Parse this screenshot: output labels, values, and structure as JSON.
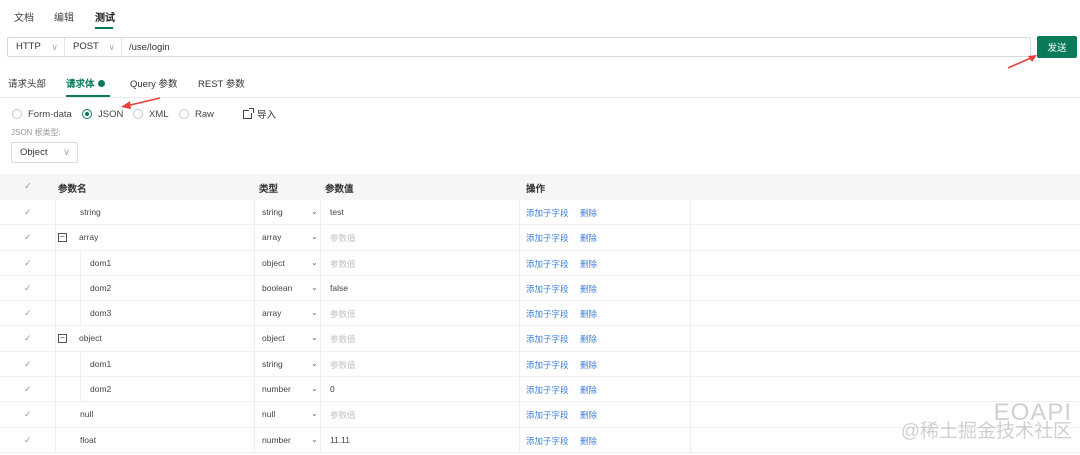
{
  "topnav": {
    "tabs": [
      "文档",
      "编辑",
      "测试"
    ],
    "active": 2
  },
  "request": {
    "protocol": "HTTP",
    "method": "POST",
    "url": "/use/login",
    "send_label": "发送"
  },
  "subtabs": {
    "items": [
      "请求头部",
      "请求体",
      "Query 参数",
      "REST 参数"
    ],
    "active": 1
  },
  "body_types": {
    "items": [
      "Form-data",
      "JSON",
      "XML",
      "Raw"
    ],
    "selected": "JSON",
    "import_label": "导入"
  },
  "root": {
    "label": "JSON 根类型:",
    "value": "Object"
  },
  "table": {
    "headers": {
      "name": "参数名",
      "type": "类型",
      "value": "参数值",
      "action": "操作"
    },
    "value_placeholder": "参数值",
    "add_child_label": "添加子字段",
    "delete_label": "删除",
    "rows": [
      {
        "name": "string",
        "type": "string",
        "value": "test",
        "level": 0,
        "collapsible": false
      },
      {
        "name": "array",
        "type": "array",
        "value": "",
        "level": 0,
        "collapsible": true
      },
      {
        "name": "dom1",
        "type": "object",
        "value": "",
        "level": 1,
        "collapsible": false
      },
      {
        "name": "dom2",
        "type": "boolean",
        "value": "false",
        "level": 1,
        "collapsible": false
      },
      {
        "name": "dom3",
        "type": "array",
        "value": "",
        "level": 1,
        "collapsible": false
      },
      {
        "name": "object",
        "type": "object",
        "value": "",
        "level": 0,
        "collapsible": true
      },
      {
        "name": "dom1",
        "type": "string",
        "value": "",
        "level": 1,
        "collapsible": false
      },
      {
        "name": "dom2",
        "type": "number",
        "value": "0",
        "level": 1,
        "collapsible": false
      },
      {
        "name": "null",
        "type": "null",
        "value": "",
        "level": 0,
        "collapsible": false
      },
      {
        "name": "float",
        "type": "number",
        "value": "11.11",
        "level": 0,
        "collapsible": false
      }
    ]
  },
  "watermark": {
    "line1": "EOAPI",
    "line2": "@稀土掘金技术社区"
  },
  "colors": {
    "accent": "#0a7a5a",
    "link": "#3d7fe0",
    "arrow": "#e8413b"
  }
}
